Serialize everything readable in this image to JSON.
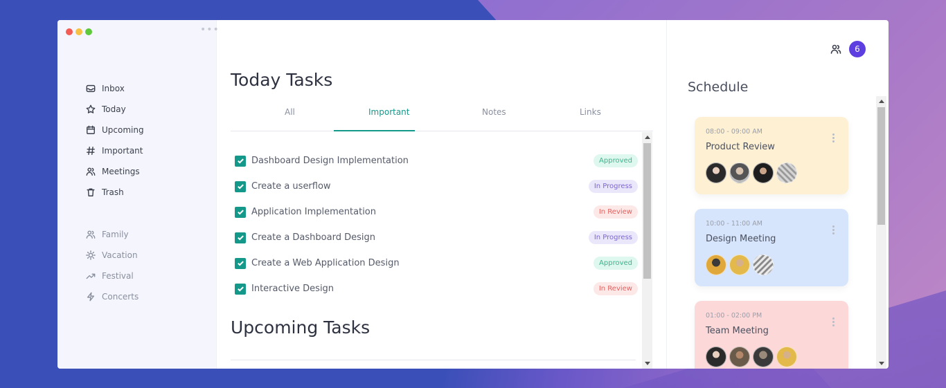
{
  "sidebar": {
    "items": [
      {
        "label": "Inbox",
        "icon": "inbox-icon"
      },
      {
        "label": "Today",
        "icon": "star-icon"
      },
      {
        "label": "Upcoming",
        "icon": "calendar-icon"
      },
      {
        "label": "Important",
        "icon": "hash-icon"
      },
      {
        "label": "Meetings",
        "icon": "users-icon"
      },
      {
        "label": "Trash",
        "icon": "trash-icon"
      }
    ],
    "labels": [
      {
        "label": "Family",
        "icon": "users-icon"
      },
      {
        "label": "Vacation",
        "icon": "sun-icon"
      },
      {
        "label": "Festival",
        "icon": "trend-icon"
      },
      {
        "label": "Concerts",
        "icon": "bolt-icon"
      }
    ]
  },
  "main": {
    "title": "Today Tasks",
    "tabs": [
      "All",
      "Important",
      "Notes",
      "Links"
    ],
    "active_tab": "Important",
    "tasks": [
      {
        "title": "Dashboard Design Implementation",
        "status": "Approved",
        "checked": true
      },
      {
        "title": "Create a userflow",
        "status": "In Progress",
        "checked": true
      },
      {
        "title": "Application Implementation",
        "status": "In Review",
        "checked": true
      },
      {
        "title": "Create a Dashboard Design",
        "status": "In Progress",
        "checked": true
      },
      {
        "title": "Create a Web Application Design",
        "status": "Approved",
        "checked": true
      },
      {
        "title": "Interactive Design",
        "status": "In Review",
        "checked": true
      }
    ],
    "upcoming_title": "Upcoming Tasks"
  },
  "header": {
    "notification_count": "6"
  },
  "schedule": {
    "title": "Schedule",
    "events": [
      {
        "time": "08:00 - 09:00 AM",
        "title": "Product Review",
        "color": "#fdf0d3"
      },
      {
        "time": "10:00 - 11:00 AM",
        "title": "Design Meeting",
        "color": "#d6e5fc"
      },
      {
        "time": "01:00 - 02:00 PM",
        "title": "Team Meeting",
        "color": "#fcd8d9"
      }
    ]
  },
  "colors": {
    "accent": "#13988a",
    "notification": "#5d3ee0"
  }
}
